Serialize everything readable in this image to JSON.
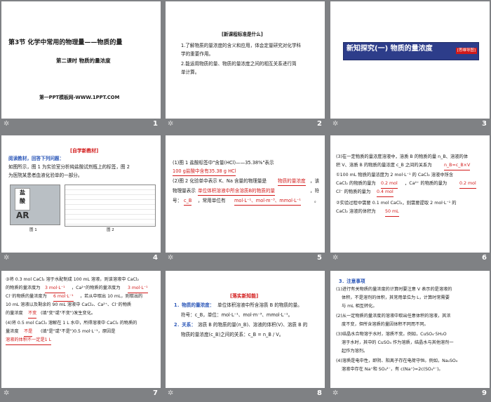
{
  "slides": [
    {
      "num": "1",
      "title": "第3节  化学中常用的物理量——物质的量",
      "subtitle": "第二课时  物质的量浓度",
      "footer": "第一PPT模板网-WWW.1PPT.COM"
    },
    {
      "num": "2",
      "heading": "[新课程标准是什么]",
      "line1": "1.了解物质的量浓度的含义和应用，体会定量研究对化学科",
      "line2": "学的重要作用。",
      "line3": "2.能运用物质的量、物质的量浓度之间的相互关系进行简",
      "line4": "单计算。"
    },
    {
      "num": "3",
      "banner": "新知探究(一)  物质的量浓度",
      "badge": "[思维导图]"
    },
    {
      "num": "4",
      "tag": "[自学新教材]",
      "line1": "阅读教材，回答下列问题：",
      "line2": "如图所示，图 1 为实验室分析纯盐酸试剂瓶上的标签，图 2",
      "line3": "为医院某患者血液化验单的一部分。",
      "label_yan": "盐",
      "label_suan": "酸",
      "label_ar": "AR",
      "fig1": "图 1",
      "fig2": "图 2"
    },
    {
      "num": "5",
      "line1": "(1)图 1 盐酸标签中\"含量(HCl)——35.38%\"表示",
      "ans1": "100 g盐酸中含有35.38 g HCl",
      "line2a": "(2)图 2 化验单中表示 K、Na 含量的物理量是",
      "ans2": "物质的量浓度",
      "line2b": "，该",
      "line3a": "物理量表示",
      "ans3": "单位体积溶液中所含溶质B的物质的量",
      "line4a": "，符",
      "line5a": "号：",
      "ans4": "c_B",
      "line5b": "，常用单位有",
      "ans5": "mol·L⁻¹、mol·m⁻³、mmol·L⁻¹",
      "line5c": "。"
    },
    {
      "num": "6",
      "line1": "(3)在一定物质的量浓度溶液中，溶质 B 的物质的量 n_B、溶液的体",
      "line2a": "积 V、溶质 B 的物质的量浓度 c_B 之间的关系为",
      "ans1": "n_B=c_B×V",
      "line3": "①100 mL 物质的量浓度为 2 mol·L⁻¹ 的 CaCl₂ 溶液中所含",
      "line4a": "CaCl₂ 的物质的量为",
      "ans2": "0.2 mol",
      "line4b": "，Ca²⁺ 的物质的量为",
      "ans3": "0.2 mol",
      "line5a": "Cl⁻ 的物质的量为",
      "ans4": "0.4 mol",
      "line6": "②实验过程中需要 0.1 mol CaCl₂，则需要提取 2 mol·L⁻¹ 的",
      "line7a": "CaCl₂ 溶液的体积为",
      "ans5": "50 mL"
    },
    {
      "num": "7",
      "line1": "③将 0.3 mol CaCl₂ 溶于水配制成 100 mL 溶液，则该溶液中 CaCl₂",
      "line2a": "的物质的量浓度为",
      "ans1": "3 mol·L⁻¹",
      "line2b": "，Ca²⁺的物质的量浓度为",
      "ans2": "3 mol·L⁻¹",
      "line3a": "Cl⁻的物质的量浓度为",
      "ans3": "6 mol·L⁻¹",
      "line3b": "，若从中取出 10 mL，则取出的",
      "line4": "10 mL 溶液以及剩余的 90 mL 溶液中 CaCl₂、Ca²⁺、Cl⁻的物质",
      "line5a": "的量浓度",
      "ans4": "不变",
      "line5b": "(填\"变\"或\"不变\")发生变化。",
      "line6": "(4)将 0.5 mol CaCl₂ 溶解在 1 L 水中，所得溶液中 CaCl₂ 的物质的",
      "line7a": "量浓度",
      "ans5": "不是",
      "line7b": "(填\"是\"或\"不是\")0.5 mol·L⁻¹，原因是",
      "ans6": "溶液的体积不一定是1 L"
    },
    {
      "num": "8",
      "heading": "[落实新知能]",
      "line1a": "1．物质的量浓度：",
      "line1b": "单位体积溶液中所含溶质 B 的物质的量。",
      "line2": "符号：c_B，单位：mol·L⁻¹、mol·m⁻³、mmol·L⁻¹。",
      "line3a": "2．关系：",
      "line3b": "溶质 B 的物质的量(n_B)、溶液的体积(V)、溶质 B 的",
      "line4": "物质的量浓度(c_B)之间的关系：c_B = n_B / V。"
    },
    {
      "num": "9",
      "heading": "3．注意事项",
      "line1": "(1)进行有关物质的量浓度的计算时要注意 V 表示的是溶液的",
      "line2": "体积，不是溶剂的体积，其常用单位为 L，计算时常需要",
      "line3": "与 mL 相互转化。",
      "line4": "(2)从一定物质的量浓度的溶液中取出任意体积的溶液，其浓",
      "line5": "度不变，但所含溶质的量因体积不同而不同。",
      "line6": "(3)结晶水合物溶于水时，溶质不变。例如，CuSO₄·5H₂O",
      "line7": "溶于水时，其中的 CuSO₄ 作为溶质，结晶水与其他溶剂一",
      "line8": "起作为溶剂。",
      "line9": "(4)溶质是电中性，即阴、阳离子存在电荷守恒。例如，Na₂SO₄",
      "line10": "溶液中存在 Na⁺和 SO₄²⁻，有 c(Na⁺)=2c(SO₄²⁻)。"
    }
  ],
  "colors": {
    "bg": "#7f8184",
    "blue": "#2a56b8",
    "red": "#d21a1a",
    "banner": "#2d3d8a"
  },
  "icons": {
    "star": "star-icon"
  }
}
